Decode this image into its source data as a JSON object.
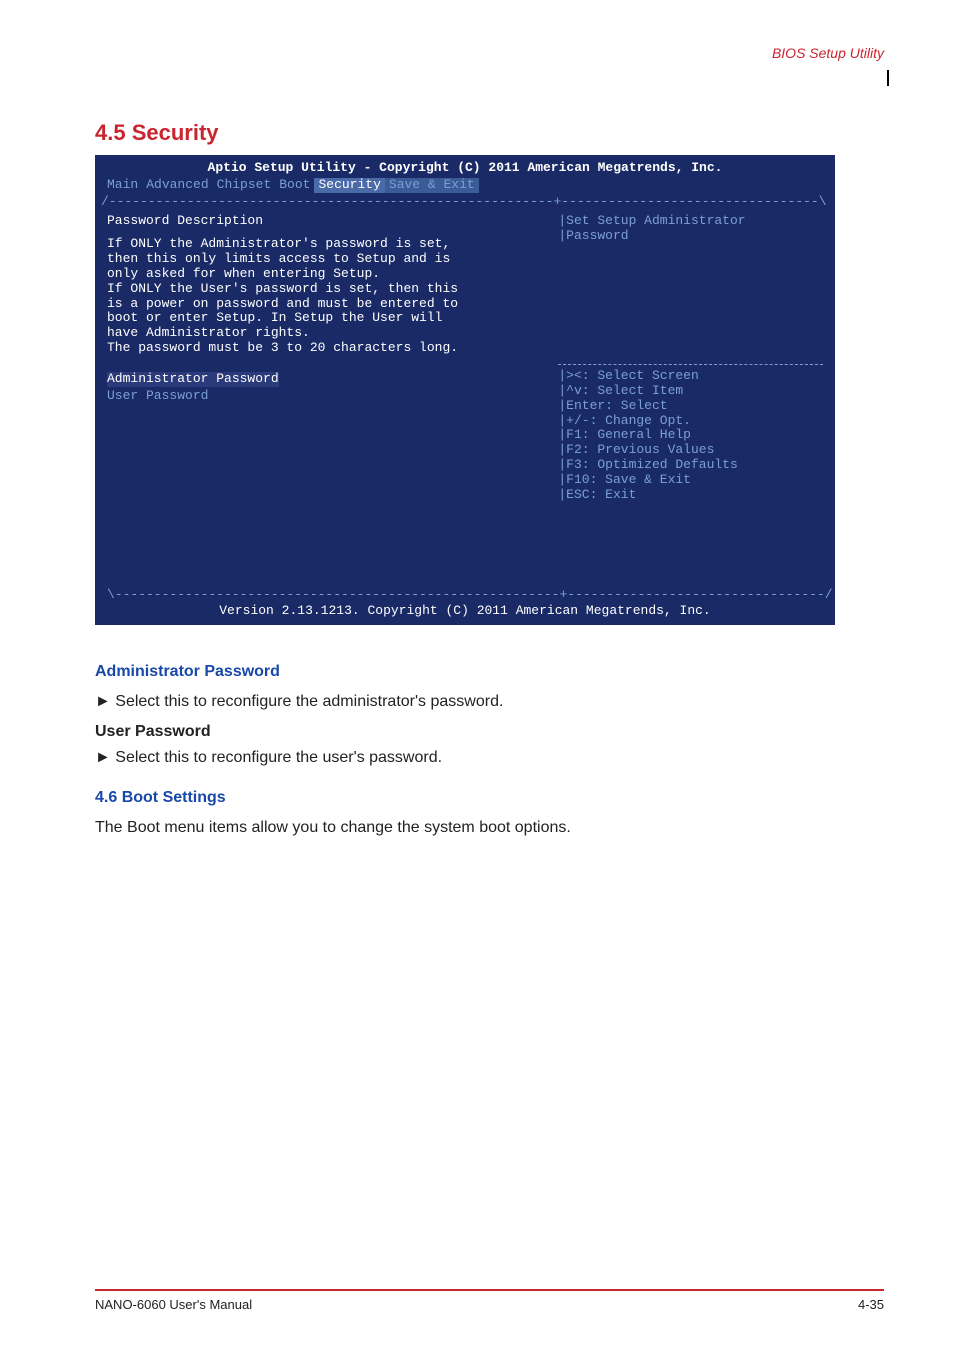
{
  "pageHeader": "BIOS Setup Utility",
  "sectionTitle": "4.5 Security",
  "bios": {
    "title": "Aptio Setup Utility - Copyright (C) 2011 American Megatrends, Inc.",
    "menu": [
      "Main",
      "Advanced",
      "Chipset",
      "Boot",
      "Security",
      "Save & Exit"
    ],
    "activeIndex": 4,
    "descHeading": "Password Description",
    "descText": "If ONLY the Administrator's password is set,\nthen this only limits access to Setup and is\nonly asked for when entering Setup.\nIf ONLY the User's password is set, then this\nis a power on password and must be entered to\nboot or enter Setup. In Setup the User will\nhave Administrator rights.\nThe password must be 3 to 20 characters long.",
    "optionSelected": "Administrator Password",
    "option2": "User Password",
    "rightHelpTop": "|Set Setup Administrator\n|Password",
    "rightHelpKeys": "|><: Select Screen\n|^v: Select Item\n|Enter: Select\n|+/-: Change Opt.\n|F1: General Help\n|F2: Previous Values\n|F3: Optimized Defaults\n|F10: Save & Exit\n|ESC: Exit",
    "footer": "Version 2.13.1213. Copyright (C) 2011 American Megatrends, Inc."
  },
  "below": {
    "sub1": "Administrator Password",
    "bullets": [
      "► Select this to reconfigure the administrator's password."
    ],
    "userTitle": "User Password",
    "userBullet": "► Select this to reconfigure the user's password.",
    "sub2": "4.6 Boot Settings",
    "para": "The Boot menu items allow you to change the system boot options."
  },
  "footer": {
    "left": "NANO-6060 User's Manual",
    "right": "4-35"
  }
}
